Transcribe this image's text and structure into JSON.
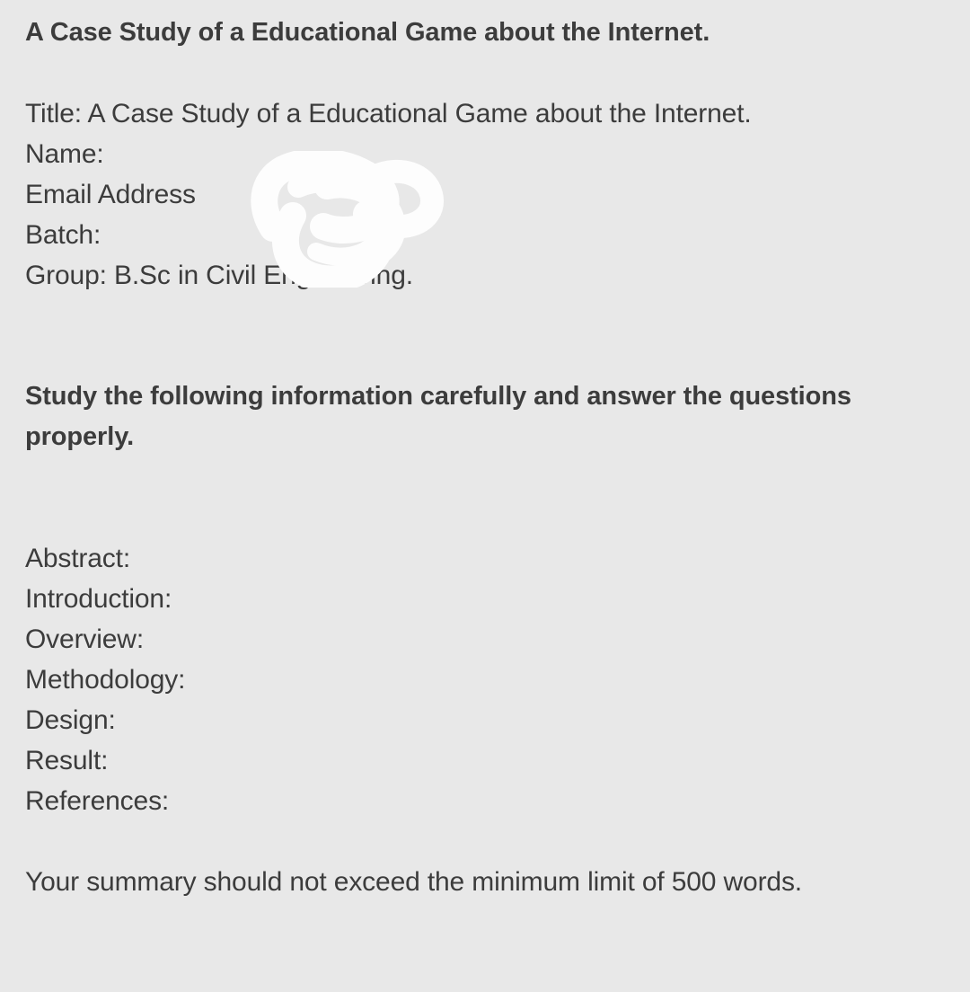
{
  "document": {
    "heading": "A Case Study of a Educational Game about the Internet.",
    "meta_block": [
      "Title: A Case Study of a Educational Game about the Internet.",
      "Name:",
      "Email Address",
      "Batch:",
      "Group: B.Sc in Civil Engineering."
    ],
    "instruction": "Study the following information carefully and answer the questions properly.",
    "sections": [
      "Abstract:",
      "Introduction:",
      "Overview:",
      "Methodology:",
      "Design:",
      "Result:",
      "References:"
    ],
    "closing_note": "Your summary should not exceed the minimum limit of 500 words."
  },
  "redaction": {
    "label": "white-scribble-redaction",
    "color": "#fdfdfd"
  },
  "theme": {
    "background": "#e8e8e8",
    "text": "#3c3c3c"
  }
}
